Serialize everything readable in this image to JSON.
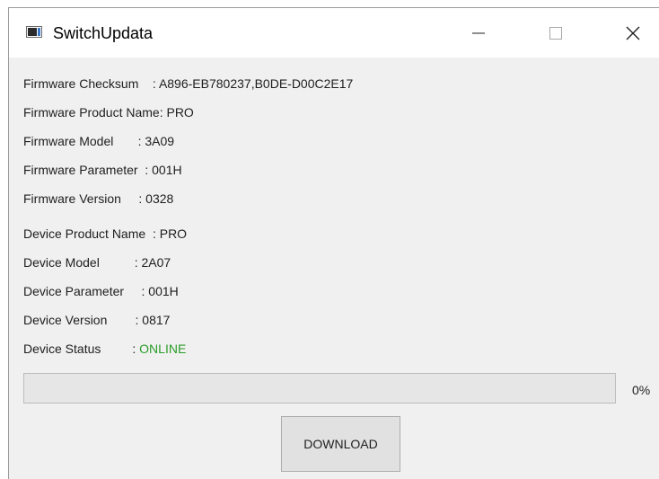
{
  "window": {
    "title": "SwitchUpdata",
    "icon": "app-window-icon"
  },
  "firmware": {
    "checksum_label": "Firmware Checksum    :",
    "checksum_value": "A896-EB780237,B0DE-D00C2E17",
    "product_name_label": "Firmware Product Name:",
    "product_name_value": "PRO",
    "model_label": "Firmware Model       :",
    "model_value": "3A09",
    "parameter_label": "Firmware Parameter  :",
    "parameter_value": "001H",
    "version_label": "Firmware Version     :",
    "version_value": "0328"
  },
  "device": {
    "product_name_label": "Device Product Name  :",
    "product_name_value": "PRO",
    "model_label": "Device Model          :",
    "model_value": "2A07",
    "parameter_label": "Device Parameter     :",
    "parameter_value": "001H",
    "version_label": "Device Version        :",
    "version_value": "0817",
    "status_label": "Device Status         :",
    "status_value": "ONLINE",
    "status_color": "#2a9d2a"
  },
  "progress": {
    "value_percent": 0,
    "label": "0%"
  },
  "actions": {
    "download_label": "DOWNLOAD"
  }
}
